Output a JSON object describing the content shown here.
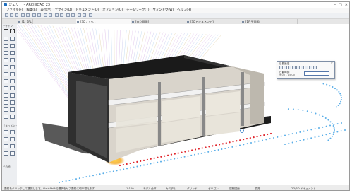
{
  "app": {
    "title": "ジェリー - ARCHICAD 23"
  },
  "window_controls": {
    "minimize": "–",
    "maximize": "□",
    "close": "✕"
  },
  "menu": [
    "ファイル(F)",
    "編集(E)",
    "表示(V)",
    "デザイン(D)",
    "ドキュメント(D)",
    "オプション(O)",
    "チームワーク(T)",
    "ウィンドウ(W)",
    "ヘルプ(H)"
  ],
  "tabs": [
    "[1. 1FL]",
    "[3D / すべて]",
    "[南立面図]",
    "[3Dドキュメント]",
    "[1F 平面図]"
  ],
  "toolbox": {
    "header_design": "デザイン",
    "header_document": "ドキュメント",
    "header_more": "その他"
  },
  "panel": {
    "title": "日影設定",
    "label": "日影時刻",
    "value": "9:00 - 15:00",
    "close": "×"
  },
  "status": {
    "message": "要素をクリックして選択します。Ctrl+Shiftで選択をサブ要素に切り替えます。",
    "items": [
      "1:100",
      "モデル全体",
      "カスタム",
      "グリッド",
      "ポリゴン",
      "建築図面",
      "現況",
      "2D/3D ドキュメント"
    ]
  },
  "colors": {
    "accent": "#1e6fbf",
    "red_path": "#e0262d",
    "blue_path": "#5aaee8",
    "sun_glow": "#f3a51c"
  }
}
